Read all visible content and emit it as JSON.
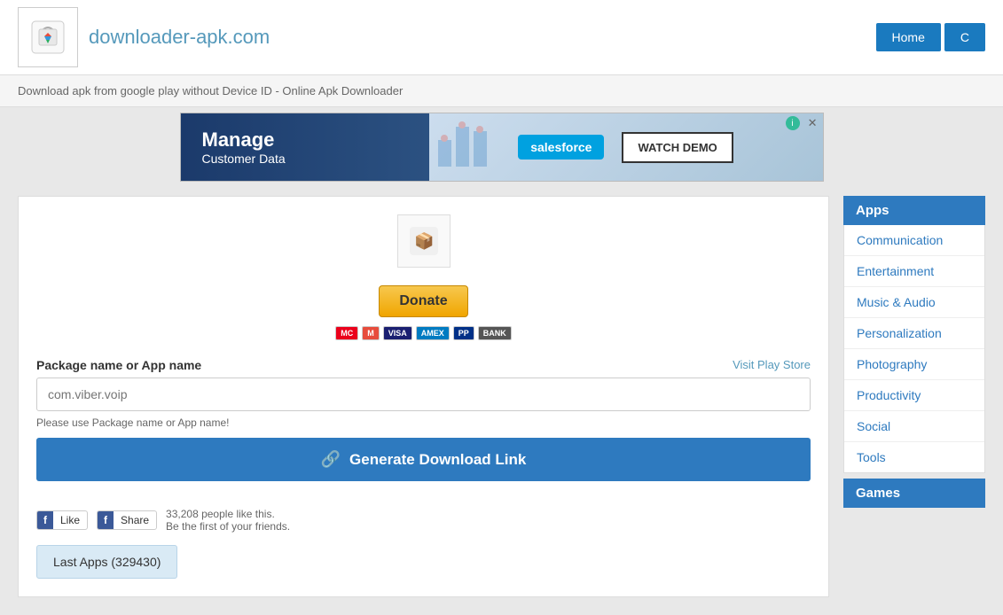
{
  "header": {
    "site_title": "downloader-apk.com",
    "nav_buttons": [
      {
        "label": "Home",
        "type": "primary"
      },
      {
        "label": "C",
        "type": "outline"
      }
    ]
  },
  "breadcrumb": {
    "text": "Download apk from google play without Device ID - Online Apk Downloader"
  },
  "ad": {
    "title": "Manage",
    "subtitle": "Customer Data",
    "cta": "WATCH DEMO",
    "brand": "salesforce",
    "info_label": "i",
    "close_label": "✕"
  },
  "content": {
    "donate_label": "Donate",
    "payment_icons": [
      "MC",
      "VISA",
      "AMEX",
      "PP",
      "BANK"
    ],
    "form": {
      "label": "Package name or App name",
      "visit_store": "Visit Play Store",
      "placeholder": "com.viber.voip",
      "hint": "Please use Package name or App name!",
      "generate_btn": "Generate Download Link",
      "link_icon": "🔗"
    },
    "facebook": {
      "like_label": "Like",
      "share_label": "Share",
      "count_text": "33,208 people like this.",
      "count_sub": "Be the first of your friends."
    },
    "last_apps_btn": "Last Apps (329430)"
  },
  "sidebar": {
    "apps_title": "Apps",
    "apps_items": [
      {
        "label": "Communication"
      },
      {
        "label": "Entertainment"
      },
      {
        "label": "Music & Audio"
      },
      {
        "label": "Personalization"
      },
      {
        "label": "Photography"
      },
      {
        "label": "Productivity"
      },
      {
        "label": "Social"
      },
      {
        "label": "Tools"
      }
    ],
    "games_title": "Games"
  }
}
